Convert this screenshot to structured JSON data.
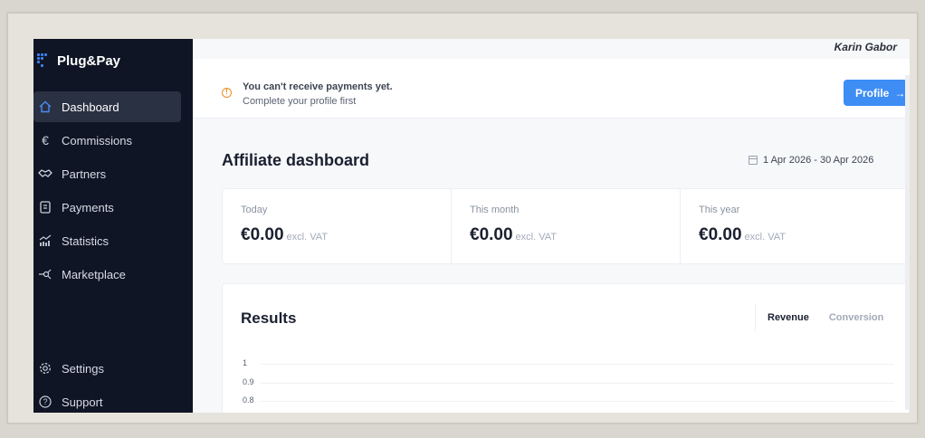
{
  "brand": {
    "name": "Plug&Pay"
  },
  "user": {
    "name": "Karin Gabor"
  },
  "nav": {
    "items": [
      {
        "label": "Dashboard",
        "icon": "home-icon",
        "active": true
      },
      {
        "label": "Commissions",
        "icon": "euro-icon"
      },
      {
        "label": "Partners",
        "icon": "handshake-icon"
      },
      {
        "label": "Payments",
        "icon": "receipt-icon"
      },
      {
        "label": "Statistics",
        "icon": "bar-chart-icon"
      },
      {
        "label": "Marketplace",
        "icon": "network-icon"
      }
    ],
    "bottom": [
      {
        "label": "Settings",
        "icon": "gear-icon"
      },
      {
        "label": "Support",
        "icon": "help-icon"
      }
    ]
  },
  "alert": {
    "title": "You can't receive payments yet.",
    "subtitle": "Complete your profile first",
    "button": "Profile",
    "button_icon": "arrow-right-icon"
  },
  "page": {
    "title": "Affiliate dashboard",
    "date_range": "1 Apr 2026 - 30 Apr 2026"
  },
  "stats": [
    {
      "label": "Today",
      "value": "€0.00",
      "note": "excl. VAT"
    },
    {
      "label": "This month",
      "value": "€0.00",
      "note": "excl. VAT"
    },
    {
      "label": "This year",
      "value": "€0.00",
      "note": "excl. VAT"
    }
  ],
  "results": {
    "title": "Results",
    "tabs": [
      "Revenue",
      "Conversion"
    ],
    "active_tab": "Revenue",
    "y_ticks": [
      "1",
      "0.9",
      "0.8"
    ]
  },
  "colors": {
    "sidebar_bg": "#0f1524",
    "accent": "#3d8df5",
    "warning": "#f08a24"
  }
}
